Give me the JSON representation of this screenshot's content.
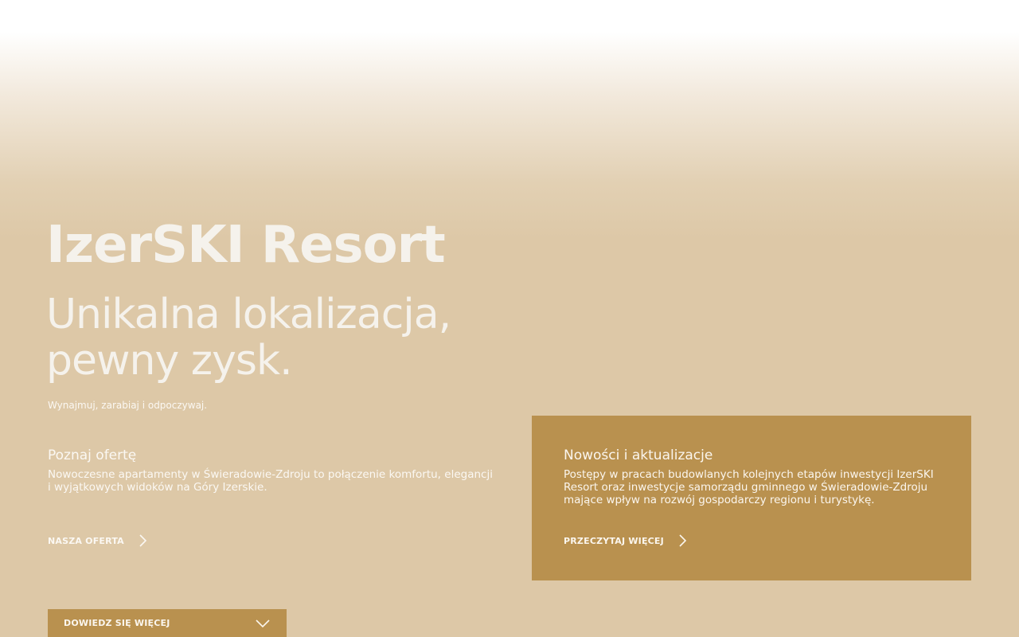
{
  "hero": {
    "title": "IzerSKI Resort",
    "subtitle_line1": "Unikalna lokalizacja,",
    "subtitle_line2": "pewny zysk.",
    "tagline": "Wynajmuj, zarabiaj i odpoczywaj."
  },
  "offer": {
    "heading": "Poznaj ofertę",
    "text": "Nowoczesne apartamenty w Świeradowie-Zdroju to połączenie komfortu, elegancji i wyjątkowych widoków na Góry Izerskie.",
    "cta_label": "NASZA OFERTA",
    "cta_icon": "chevron-right-icon"
  },
  "news": {
    "heading": "Nowości i aktualizacje",
    "text": "Postępy w pracach budowlanych kolejnych etapów inwestycji IzerSKI Resort oraz inwestycje samorządu gminnego w Świeradowie-Zdroju mające wpływ na rozwój gospodarczy regionu i turystykę.",
    "cta_label": "PRZECZYTAJ WIĘCEJ",
    "cta_icon": "chevron-right-icon"
  },
  "more_bar": {
    "label": "DOWIEDZ SIĘ WIĘCEJ",
    "icon": "chevron-down-icon"
  },
  "colors": {
    "background": "#ddc8a7",
    "accent": "#b9914f",
    "text_light": "#f5f2ec"
  }
}
